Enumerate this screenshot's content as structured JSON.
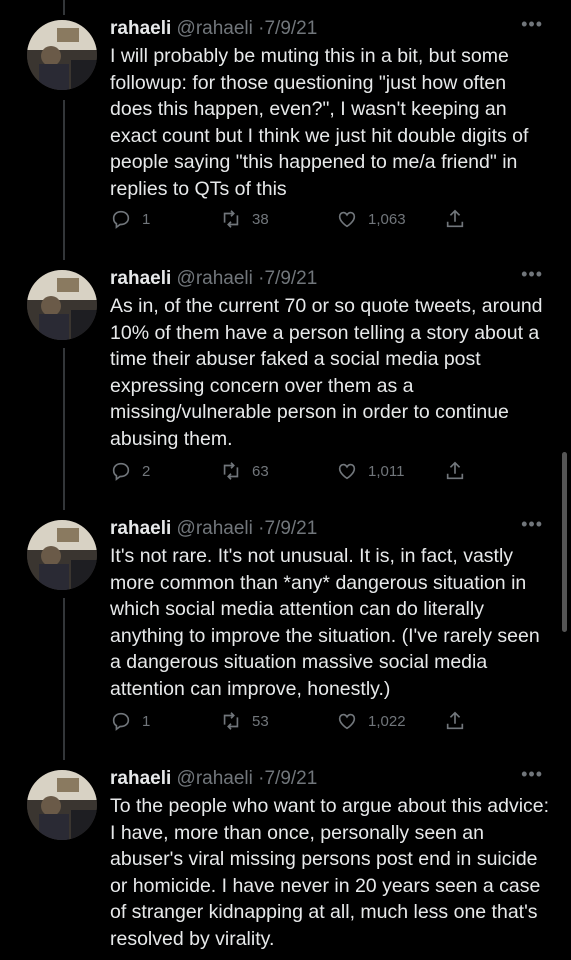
{
  "tweets": [
    {
      "name": "rahaeli",
      "handle": "@rahaeli",
      "date": "7/9/21",
      "text": "I will probably be muting this in a bit, but some followup: for those questioning \"just how often does this happen, even?\", I wasn't keeping an exact count but I think we just hit double digits of people saying \"this happened to me/a friend\" in replies to QTs of this",
      "replies": "1",
      "retweets": "38",
      "likes": "1,063"
    },
    {
      "name": "rahaeli",
      "handle": "@rahaeli",
      "date": "7/9/21",
      "text": "As in, of the current 70 or so quote tweets, around 10% of them have a person telling a story about a time their abuser faked a social media post expressing concern over them as a missing/vulnerable person in order to continue abusing them.",
      "replies": "2",
      "retweets": "63",
      "likes": "1,011"
    },
    {
      "name": "rahaeli",
      "handle": "@rahaeli",
      "date": "7/9/21",
      "text": "It's not rare. It's not unusual. It is, in fact, vastly more common than *any* dangerous situation in which social media attention can do literally anything to improve the situation. (I've rarely seen a dangerous situation massive social media attention can improve, honestly.)",
      "replies": "1",
      "retweets": "53",
      "likes": "1,022"
    },
    {
      "name": "rahaeli",
      "handle": "@rahaeli",
      "date": "7/9/21",
      "text": "To the people who want to argue about this advice: I have, more than once, personally seen an abuser's viral missing persons post end in suicide or homicide. I have never in 20 years seen a case of stranger kidnapping at all, much less one that's resolved by virality.",
      "replies": "",
      "retweets": "",
      "likes": ""
    }
  ],
  "separator": "·",
  "more_glyph": "•••",
  "icons": [
    "reply-icon",
    "retweet-icon",
    "like-icon",
    "share-icon"
  ],
  "colors": {
    "background": "#000000",
    "text": "#e7e9ea",
    "muted": "#71767b"
  }
}
